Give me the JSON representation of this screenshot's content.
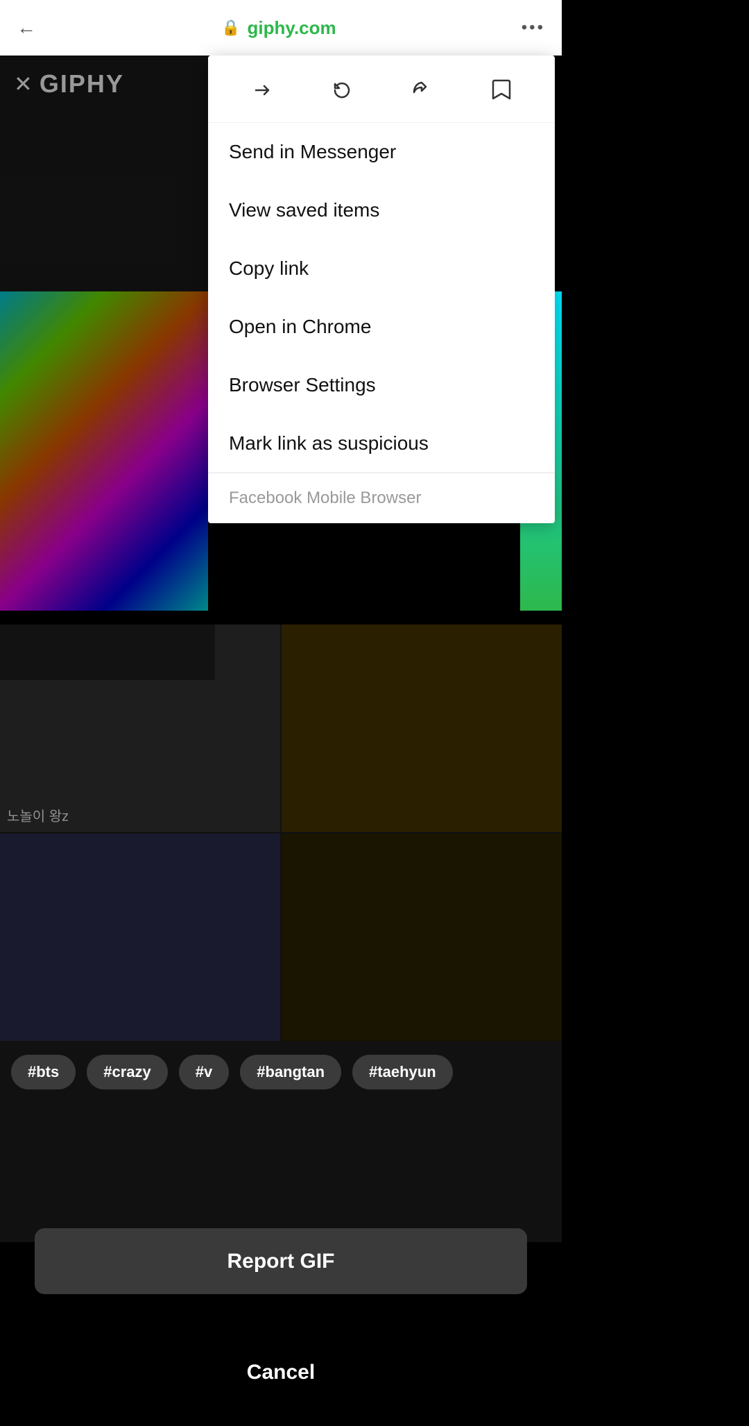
{
  "browser": {
    "url": "giphy.com",
    "back_label": "←",
    "more_label": "•••",
    "lock_icon": "🔒"
  },
  "giphy": {
    "close_label": "✕",
    "logo_label": "GIPHY"
  },
  "dropdown": {
    "icons": [
      {
        "name": "forward-icon",
        "symbol": "→",
        "label": "Forward"
      },
      {
        "name": "reload-icon",
        "symbol": "↻",
        "label": "Reload"
      },
      {
        "name": "share-icon",
        "symbol": "⎙",
        "label": "Share"
      },
      {
        "name": "bookmark-icon",
        "symbol": "⎕",
        "label": "Bookmark"
      }
    ],
    "items": [
      {
        "key": "send-messenger",
        "label": "Send in Messenger"
      },
      {
        "key": "view-saved",
        "label": "View saved items"
      },
      {
        "key": "copy-link",
        "label": "Copy link"
      },
      {
        "key": "open-chrome",
        "label": "Open in Chrome"
      },
      {
        "key": "browser-settings",
        "label": "Browser Settings"
      },
      {
        "key": "mark-suspicious",
        "label": "Mark link as suspicious"
      }
    ],
    "footer_label": "Facebook Mobile Browser"
  },
  "tags": [
    "#bts",
    "#crazy",
    "#v",
    "#bangtan",
    "#taehyun"
  ],
  "gif_text": "노놀이 왕z",
  "actions": {
    "report_gif": "Report GIF",
    "cancel": "Cancel"
  }
}
